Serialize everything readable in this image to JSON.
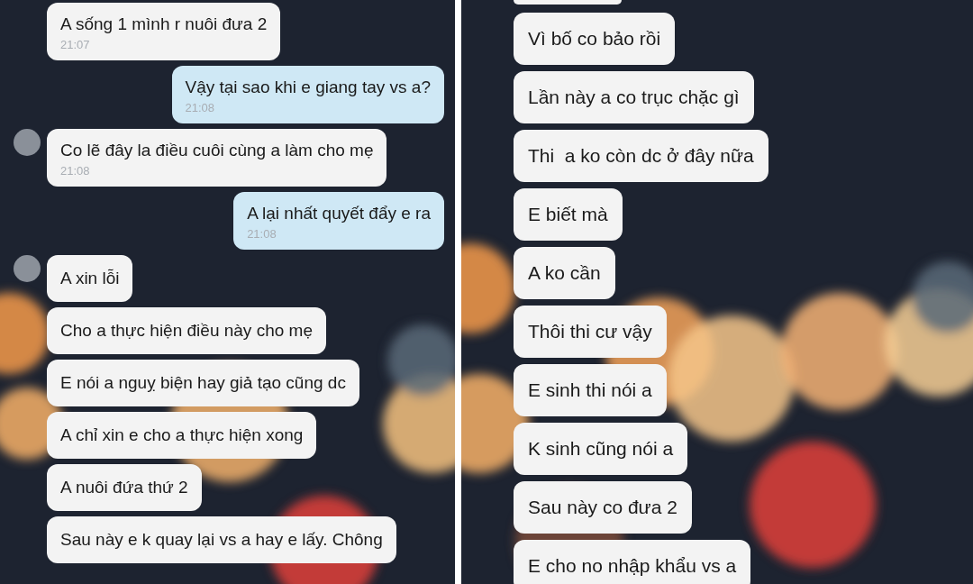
{
  "panels": [
    {
      "messages": [
        {
          "kind": "incoming",
          "text": "A sống 1 mình r nuôi đưa 2",
          "time": "21:07",
          "avatar": false
        },
        {
          "kind": "outgoing",
          "text": "Vậy tại sao khi e giang tay vs a?",
          "time": "21:08"
        },
        {
          "kind": "incoming",
          "text": "Co lẽ đây la điều cuôi cùng a làm cho mẹ",
          "time": "21:08",
          "avatar": true
        },
        {
          "kind": "outgoing",
          "text": "A lại nhất quyết đẩy e ra",
          "time": "21:08"
        },
        {
          "kind": "incoming",
          "text": "A xin lỗi",
          "avatar": true
        },
        {
          "kind": "incoming",
          "text": "Cho a thực hiện điều này cho mẹ",
          "avatar": false
        },
        {
          "kind": "incoming",
          "text": "E nói a nguỵ biện hay giả tạo cũng dc",
          "avatar": false
        },
        {
          "kind": "incoming",
          "text": "A chỉ xin e cho a thực hiện xong",
          "avatar": false
        },
        {
          "kind": "incoming",
          "text": "A nuôi đứa thứ 2",
          "avatar": false
        },
        {
          "kind": "incoming",
          "text": "Sau này e k quay lại vs a hay e lấy. Chông",
          "avatar": false
        }
      ]
    },
    {
      "messages": [
        {
          "kind": "partial"
        },
        {
          "kind": "incoming",
          "text": "Vì bố co bảo rồi"
        },
        {
          "kind": "incoming",
          "text": "Lần này a co trục chặc gì"
        },
        {
          "kind": "incoming",
          "text": "Thi  a ko còn dc ở đây nữa"
        },
        {
          "kind": "incoming",
          "text": "E biết mà"
        },
        {
          "kind": "incoming",
          "text": "A ko cần"
        },
        {
          "kind": "incoming",
          "text": "Thôi thi cư vậy"
        },
        {
          "kind": "incoming",
          "text": "E sinh thi nói a"
        },
        {
          "kind": "incoming",
          "text": "K sinh cũng nói a"
        },
        {
          "kind": "incoming",
          "text": "Sau này co đưa 2"
        },
        {
          "kind": "incoming",
          "text": "E cho no nhập khẩu vs a"
        }
      ]
    }
  ]
}
